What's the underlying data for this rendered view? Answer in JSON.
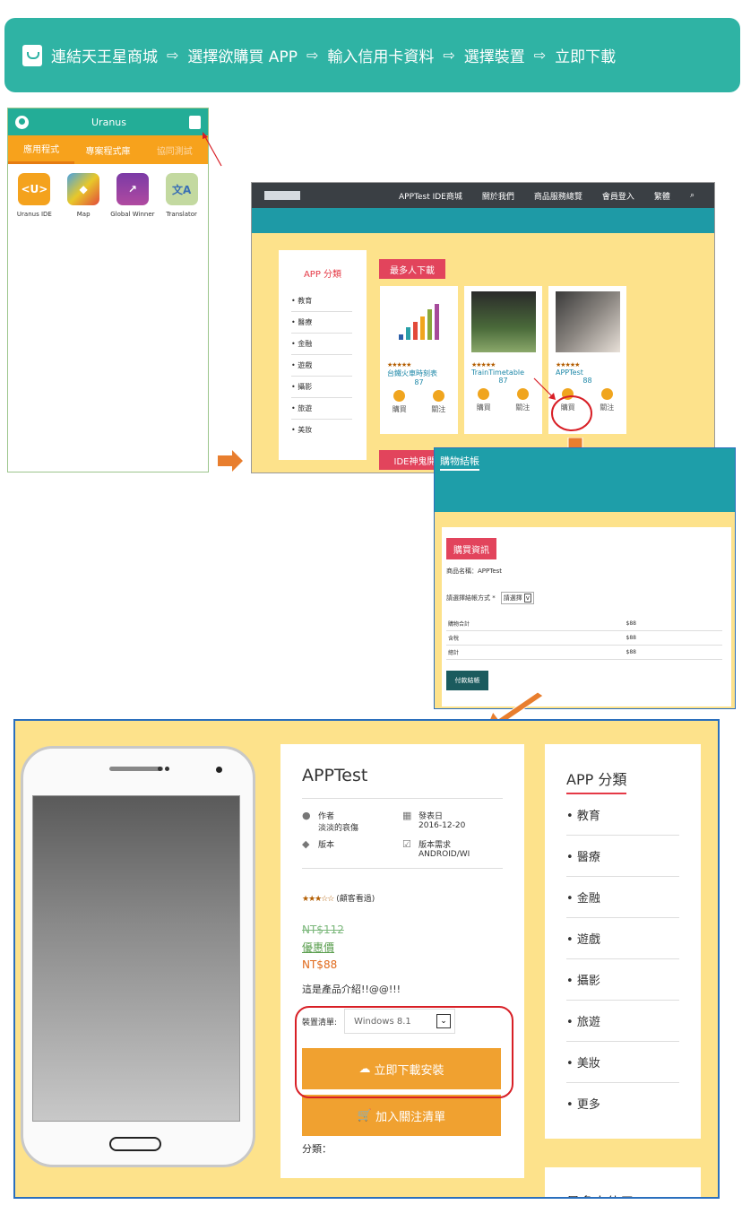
{
  "banner": {
    "steps": [
      "連結天王星商城",
      "選擇欲購買 APP",
      "輸入信用卡資料",
      "選擇裝置",
      "立即下載"
    ],
    "arrow": "⇨"
  },
  "app": {
    "title": "Uranus",
    "tabs": [
      "應用程式",
      "專案程式庫",
      "協同測試"
    ],
    "icons": [
      {
        "label": "Uranus IDE",
        "glyph": "<U>",
        "color": "#f4a21d"
      },
      {
        "label": "Map",
        "glyph": "◆",
        "color": "#e8c82a"
      },
      {
        "label": "Global Winner",
        "glyph": "↗",
        "color": "#7b3aa6"
      },
      {
        "label": "Translator",
        "glyph": "文A",
        "color": "#c3d9a0"
      }
    ]
  },
  "web": {
    "nav": [
      "APPTest IDE商城",
      "關於我們",
      "商品服務總覽",
      "會員登入",
      "繁體"
    ],
    "side_title": "APP 分類",
    "side_items": [
      "教育",
      "醫療",
      "金融",
      "遊戲",
      "攝影",
      "旅遊",
      "美妝"
    ],
    "hot_label": "最多人下載",
    "ide_label": "IDE神鬼開",
    "cards": [
      {
        "name": "台鐵火車時刻表",
        "count": "87",
        "stars": "★★★★★",
        "buy": "購買",
        "follow": "關注",
        "pic_color": "#ffffff"
      },
      {
        "name": "TrainTimetable",
        "count": "87",
        "stars": "★★★★★",
        "buy": "購買",
        "follow": "關注",
        "pic_color": "#6a7a5a"
      },
      {
        "name": "APPTest",
        "count": "88",
        "stars": "★★★★★",
        "buy": "購買",
        "follow": "關注",
        "pic_color": "#5a5450"
      }
    ]
  },
  "checkout": {
    "title": "購物結帳",
    "info_label": "購買資訊",
    "product_name": "商品名稱：APPTest",
    "pay_method_label": "請選擇結帳方式 *",
    "pay_method_value": "請選擇",
    "rows": [
      {
        "label": "購物合計",
        "value": "$88"
      },
      {
        "label": "含稅",
        "value": "$88"
      },
      {
        "label": "總計",
        "value": "$88"
      }
    ],
    "pay_button": "付款結帳"
  },
  "product": {
    "title": "APPTest",
    "author_label": "作者",
    "author": "淡淡的哀傷",
    "date_label": "發表日",
    "date": "2016-12-20",
    "version_label": "版本",
    "req_label": "版本需求",
    "req": "ANDROID/WI",
    "stars": "★★★☆☆",
    "rating_text": "(顧客看過)",
    "old_price": "NT$112",
    "discount_label": "優惠價",
    "price": "NT$88",
    "description": "這是產品介紹!!@@!!!",
    "device_label": "裝置清單:",
    "device_value": "Windows 8.1",
    "download_button": "立即下載安裝",
    "wishlist_button": "加入關注清單",
    "category_label": "分類："
  },
  "categories": {
    "title": "APP 分類",
    "items": [
      "教育",
      "醫療",
      "金融",
      "遊戲",
      "攝影",
      "旅遊",
      "美妝",
      "更多"
    ],
    "more_title": "最多人使用"
  }
}
